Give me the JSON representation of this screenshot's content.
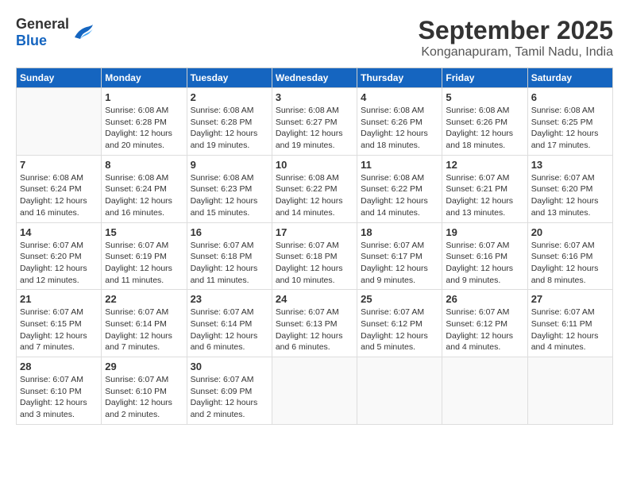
{
  "logo": {
    "general": "General",
    "blue": "Blue"
  },
  "title": "September 2025",
  "subtitle": "Konganapuram, Tamil Nadu, India",
  "headers": [
    "Sunday",
    "Monday",
    "Tuesday",
    "Wednesday",
    "Thursday",
    "Friday",
    "Saturday"
  ],
  "weeks": [
    [
      {
        "day": "",
        "info": ""
      },
      {
        "day": "1",
        "info": "Sunrise: 6:08 AM\nSunset: 6:28 PM\nDaylight: 12 hours\nand 20 minutes."
      },
      {
        "day": "2",
        "info": "Sunrise: 6:08 AM\nSunset: 6:28 PM\nDaylight: 12 hours\nand 19 minutes."
      },
      {
        "day": "3",
        "info": "Sunrise: 6:08 AM\nSunset: 6:27 PM\nDaylight: 12 hours\nand 19 minutes."
      },
      {
        "day": "4",
        "info": "Sunrise: 6:08 AM\nSunset: 6:26 PM\nDaylight: 12 hours\nand 18 minutes."
      },
      {
        "day": "5",
        "info": "Sunrise: 6:08 AM\nSunset: 6:26 PM\nDaylight: 12 hours\nand 18 minutes."
      },
      {
        "day": "6",
        "info": "Sunrise: 6:08 AM\nSunset: 6:25 PM\nDaylight: 12 hours\nand 17 minutes."
      }
    ],
    [
      {
        "day": "7",
        "info": "Sunrise: 6:08 AM\nSunset: 6:24 PM\nDaylight: 12 hours\nand 16 minutes."
      },
      {
        "day": "8",
        "info": "Sunrise: 6:08 AM\nSunset: 6:24 PM\nDaylight: 12 hours\nand 16 minutes."
      },
      {
        "day": "9",
        "info": "Sunrise: 6:08 AM\nSunset: 6:23 PM\nDaylight: 12 hours\nand 15 minutes."
      },
      {
        "day": "10",
        "info": "Sunrise: 6:08 AM\nSunset: 6:22 PM\nDaylight: 12 hours\nand 14 minutes."
      },
      {
        "day": "11",
        "info": "Sunrise: 6:08 AM\nSunset: 6:22 PM\nDaylight: 12 hours\nand 14 minutes."
      },
      {
        "day": "12",
        "info": "Sunrise: 6:07 AM\nSunset: 6:21 PM\nDaylight: 12 hours\nand 13 minutes."
      },
      {
        "day": "13",
        "info": "Sunrise: 6:07 AM\nSunset: 6:20 PM\nDaylight: 12 hours\nand 13 minutes."
      }
    ],
    [
      {
        "day": "14",
        "info": "Sunrise: 6:07 AM\nSunset: 6:20 PM\nDaylight: 12 hours\nand 12 minutes."
      },
      {
        "day": "15",
        "info": "Sunrise: 6:07 AM\nSunset: 6:19 PM\nDaylight: 12 hours\nand 11 minutes."
      },
      {
        "day": "16",
        "info": "Sunrise: 6:07 AM\nSunset: 6:18 PM\nDaylight: 12 hours\nand 11 minutes."
      },
      {
        "day": "17",
        "info": "Sunrise: 6:07 AM\nSunset: 6:18 PM\nDaylight: 12 hours\nand 10 minutes."
      },
      {
        "day": "18",
        "info": "Sunrise: 6:07 AM\nSunset: 6:17 PM\nDaylight: 12 hours\nand 9 minutes."
      },
      {
        "day": "19",
        "info": "Sunrise: 6:07 AM\nSunset: 6:16 PM\nDaylight: 12 hours\nand 9 minutes."
      },
      {
        "day": "20",
        "info": "Sunrise: 6:07 AM\nSunset: 6:16 PM\nDaylight: 12 hours\nand 8 minutes."
      }
    ],
    [
      {
        "day": "21",
        "info": "Sunrise: 6:07 AM\nSunset: 6:15 PM\nDaylight: 12 hours\nand 7 minutes."
      },
      {
        "day": "22",
        "info": "Sunrise: 6:07 AM\nSunset: 6:14 PM\nDaylight: 12 hours\nand 7 minutes."
      },
      {
        "day": "23",
        "info": "Sunrise: 6:07 AM\nSunset: 6:14 PM\nDaylight: 12 hours\nand 6 minutes."
      },
      {
        "day": "24",
        "info": "Sunrise: 6:07 AM\nSunset: 6:13 PM\nDaylight: 12 hours\nand 6 minutes."
      },
      {
        "day": "25",
        "info": "Sunrise: 6:07 AM\nSunset: 6:12 PM\nDaylight: 12 hours\nand 5 minutes."
      },
      {
        "day": "26",
        "info": "Sunrise: 6:07 AM\nSunset: 6:12 PM\nDaylight: 12 hours\nand 4 minutes."
      },
      {
        "day": "27",
        "info": "Sunrise: 6:07 AM\nSunset: 6:11 PM\nDaylight: 12 hours\nand 4 minutes."
      }
    ],
    [
      {
        "day": "28",
        "info": "Sunrise: 6:07 AM\nSunset: 6:10 PM\nDaylight: 12 hours\nand 3 minutes."
      },
      {
        "day": "29",
        "info": "Sunrise: 6:07 AM\nSunset: 6:10 PM\nDaylight: 12 hours\nand 2 minutes."
      },
      {
        "day": "30",
        "info": "Sunrise: 6:07 AM\nSunset: 6:09 PM\nDaylight: 12 hours\nand 2 minutes."
      },
      {
        "day": "",
        "info": ""
      },
      {
        "day": "",
        "info": ""
      },
      {
        "day": "",
        "info": ""
      },
      {
        "day": "",
        "info": ""
      }
    ]
  ]
}
